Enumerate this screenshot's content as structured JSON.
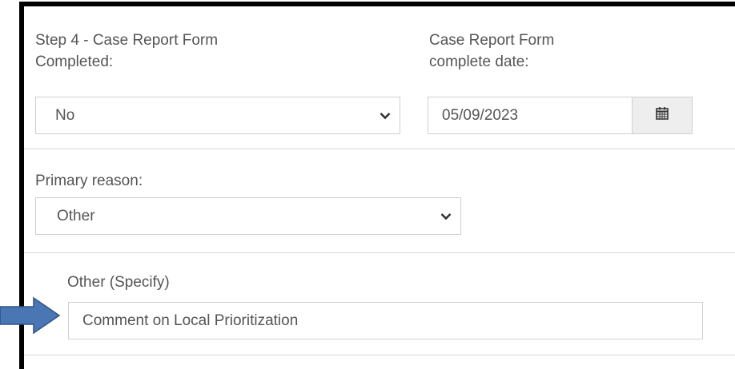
{
  "step4": {
    "label_line1": "Step 4 - Case Report Form",
    "label_line2": "Completed:",
    "selected": "No"
  },
  "complete_date": {
    "label_line1": "Case Report Form",
    "label_line2": "complete date:",
    "value": "05/09/2023"
  },
  "primary_reason": {
    "label": "Primary reason:",
    "selected": "Other"
  },
  "other_specify": {
    "label": "Other (Specify)",
    "value": "Comment on Local Prioritization"
  },
  "colors": {
    "arrow_fill": "#4a77b4",
    "arrow_stroke": "#2c5486",
    "border": "#cfcfcf"
  },
  "icons": [
    "chevron-down-icon",
    "calendar-icon",
    "right-arrow-icon"
  ]
}
